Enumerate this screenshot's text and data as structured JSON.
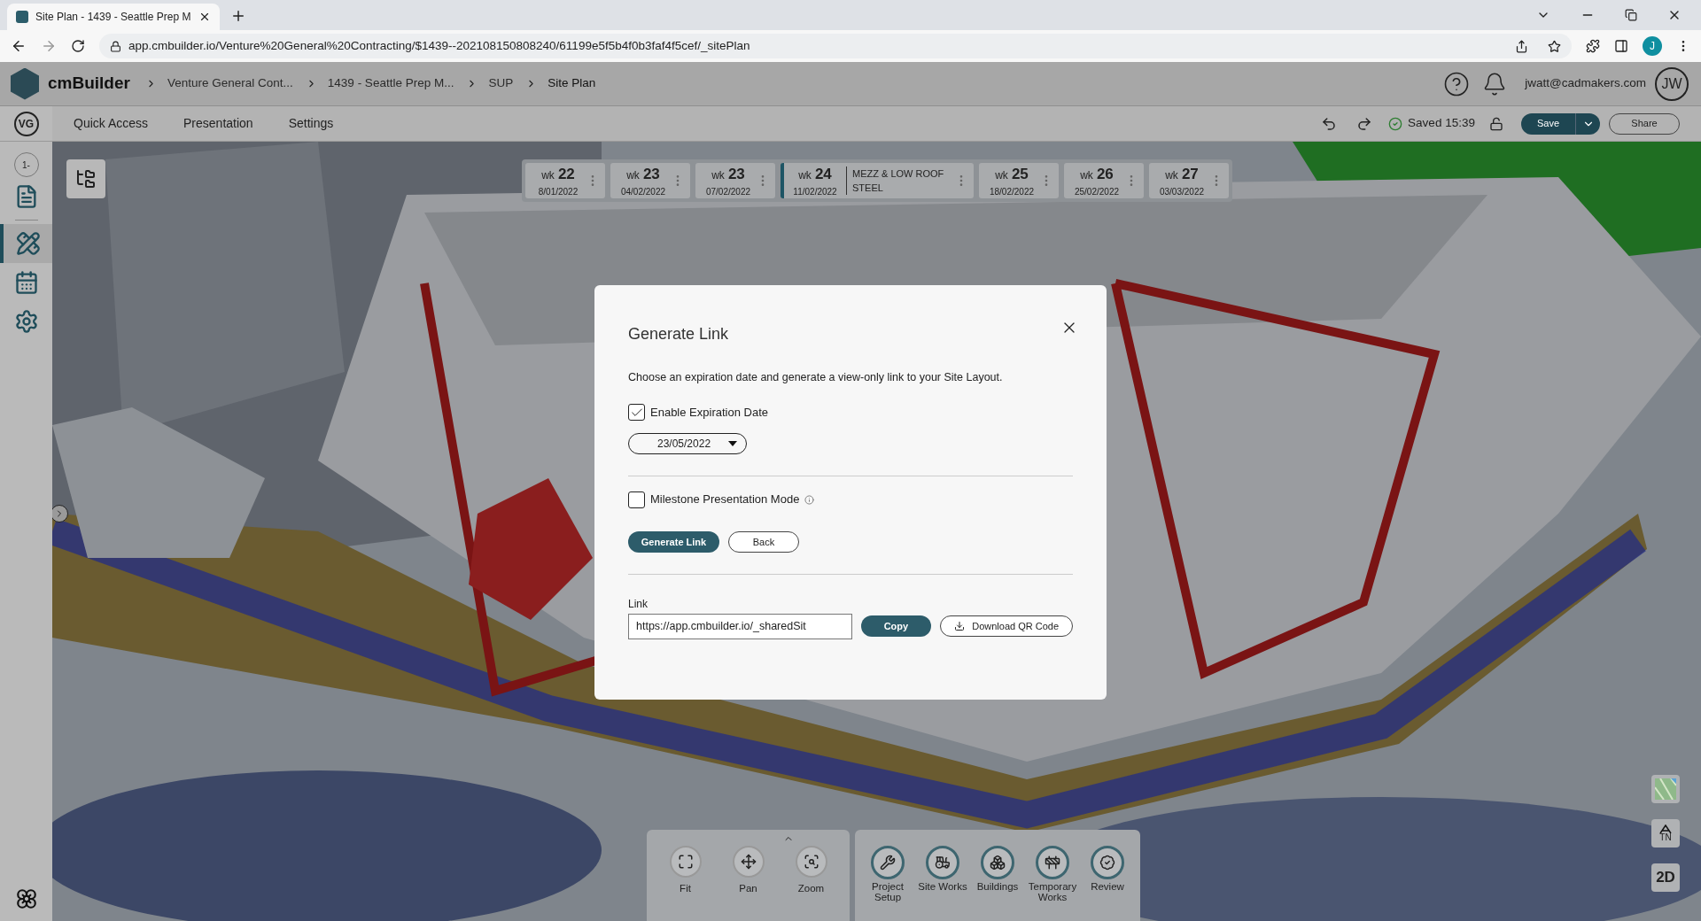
{
  "browser": {
    "tab_title": "Site Plan - 1439 - Seattle Prep M",
    "url": "app.cmbuilder.io/Venture%20General%20Contracting/$1439--202108150808240/61199e5f5b4f0b3faf4f5cef/_sitePlan",
    "profile": "J"
  },
  "header": {
    "brand": "cmBuilder",
    "breadcrumbs": [
      "Venture General Cont...",
      "1439 - Seattle Prep M...",
      "SUP",
      "Site Plan"
    ],
    "email": "jwatt@cadmakers.com",
    "avatar": "JW"
  },
  "toolbar": {
    "menu": [
      "Quick Access",
      "Presentation",
      "Settings"
    ],
    "saved": "Saved 15:39",
    "save": "Save",
    "share": "Share"
  },
  "sidebar": {
    "org": "VG",
    "badge": "1-",
    "items": [
      {
        "kind": "document",
        "selected": false
      },
      {
        "kind": "design",
        "selected": true
      },
      {
        "kind": "schedule",
        "selected": false
      },
      {
        "kind": "settings",
        "selected": false
      }
    ]
  },
  "timeline": [
    {
      "label": "wk",
      "number": "22",
      "date": "8/01/2022",
      "selected": false
    },
    {
      "label": "wk",
      "number": "23",
      "date": "04/02/2022",
      "selected": false
    },
    {
      "label": "wk",
      "number": "23",
      "date": "07/02/2022",
      "selected": false
    },
    {
      "label": "wk",
      "number": "24",
      "date": "11/02/2022",
      "selected": true,
      "note": [
        "MEZZ & LOW ROOF",
        "STEEL"
      ]
    },
    {
      "label": "wk",
      "number": "25",
      "date": "18/02/2022",
      "selected": false
    },
    {
      "label": "wk",
      "number": "26",
      "date": "25/02/2022",
      "selected": false
    },
    {
      "label": "wk",
      "number": "27",
      "date": "03/03/2022",
      "selected": false
    }
  ],
  "dialog": {
    "title": "Generate Link",
    "description": "Choose an expiration date and generate a view-only link to your Site Layout.",
    "expiration": {
      "label": "Enable Expiration Date",
      "checked": true,
      "date": "23/05/2022"
    },
    "milestone": {
      "label": "Milestone Presentation Mode",
      "checked": false
    },
    "generate": "Generate Link",
    "back": "Back",
    "link_label": "Link",
    "link_value": "https://app.cmbuilder.io/_sharedSit",
    "copy": "Copy",
    "download": "Download QR Code"
  },
  "view_tools": [
    "Fit",
    "Pan",
    "Zoom"
  ],
  "modules": [
    {
      "kind": "setup",
      "label": "Project Setup"
    },
    {
      "kind": "siteworks",
      "label": "Site Works"
    },
    {
      "kind": "buildings",
      "label": "Buildings"
    },
    {
      "kind": "temporary",
      "label": "Temporary Works"
    },
    {
      "kind": "review",
      "label": "Review"
    }
  ],
  "map_controls": {
    "north": "TN",
    "view": "2D"
  }
}
